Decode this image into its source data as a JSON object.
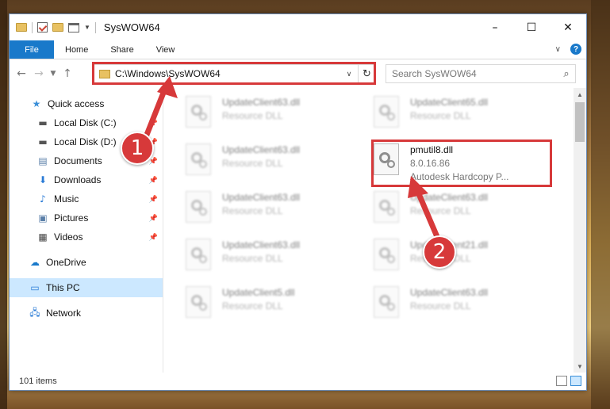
{
  "window": {
    "title": "SysWOW64",
    "controls": {
      "minimize": "–",
      "maximize": "☐",
      "close": "✕"
    }
  },
  "ribbon": {
    "tabs": [
      "File",
      "Home",
      "Share",
      "View"
    ]
  },
  "address": {
    "path": "C:\\Windows\\SysWOW64",
    "search_placeholder": "Search SysWOW64"
  },
  "nav": {
    "items": [
      {
        "label": "Quick access",
        "icon": "star-icon",
        "pinned": false
      },
      {
        "label": "Local Disk (C:)",
        "icon": "drive-icon",
        "pinned": true
      },
      {
        "label": "Local Disk (D:)",
        "icon": "drive-icon",
        "pinned": true
      },
      {
        "label": "Documents",
        "icon": "documents-icon",
        "pinned": true
      },
      {
        "label": "Downloads",
        "icon": "download-icon",
        "pinned": true
      },
      {
        "label": "Music",
        "icon": "music-icon",
        "pinned": true
      },
      {
        "label": "Pictures",
        "icon": "pictures-icon",
        "pinned": true
      },
      {
        "label": "Videos",
        "icon": "videos-icon",
        "pinned": true
      },
      {
        "label": "OneDrive",
        "icon": "cloud-icon",
        "pinned": false
      },
      {
        "label": "This PC",
        "icon": "pc-icon",
        "pinned": false,
        "selected": true
      },
      {
        "label": "Network",
        "icon": "network-icon",
        "pinned": false
      }
    ]
  },
  "files": {
    "col1": [
      {
        "name": "UpdateClient63.dll",
        "sub": "Resource DLL"
      },
      {
        "name": "UpdateClient63.dll",
        "sub": "Resource DLL"
      },
      {
        "name": "UpdateClient63.dll",
        "sub": "Resource DLL"
      },
      {
        "name": "UpdateClient63.dll",
        "sub": "Resource DLL"
      },
      {
        "name": "UpdateClient5.dll",
        "sub": "Resource DLL"
      }
    ],
    "col2": [
      {
        "name": "UpdateClient65.dll",
        "sub": "Resource DLL"
      },
      {
        "name": "UpdateClient63.dll",
        "sub": "Resource DLL"
      },
      {
        "name": "UpdateClient21.dll",
        "sub": "Resource DLL"
      },
      {
        "name": "UpdateClient63.dll",
        "sub": "Resource DLL"
      }
    ],
    "highlighted": {
      "name": "pmutil8.dll",
      "version": "8.0.16.86",
      "description": "Autodesk Hardcopy P..."
    }
  },
  "status": {
    "item_count": "101 items"
  },
  "annotations": {
    "badge1": "1",
    "badge2": "2"
  },
  "colors": {
    "accent": "#1979ca",
    "highlight": "#d7393a",
    "selection": "#cce8ff"
  }
}
